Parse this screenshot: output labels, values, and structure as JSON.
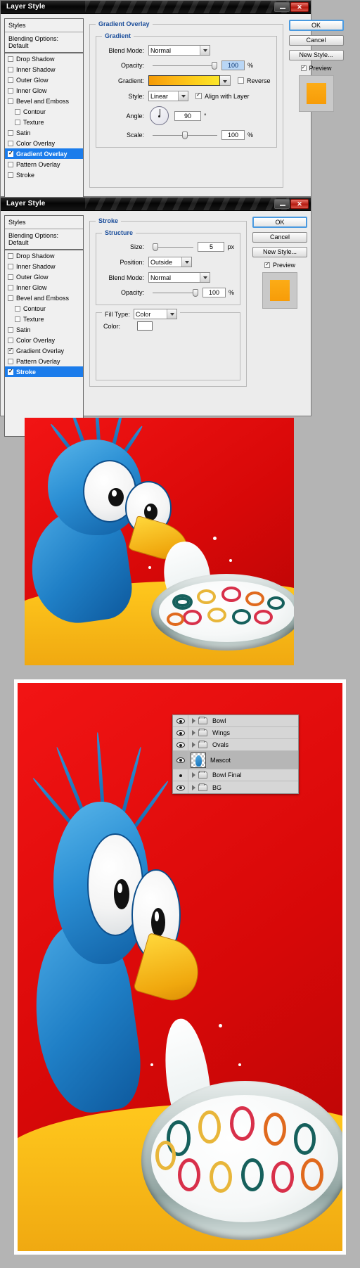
{
  "dialogs": [
    {
      "title": "Layer Style",
      "win_minimize": "",
      "win_close": "✕",
      "styles_header": "Styles",
      "blending_options": "Blending Options: Default",
      "style_items": [
        {
          "label": "Drop Shadow",
          "checked": false,
          "sub": false,
          "selected": false
        },
        {
          "label": "Inner Shadow",
          "checked": false,
          "sub": false,
          "selected": false
        },
        {
          "label": "Outer Glow",
          "checked": false,
          "sub": false,
          "selected": false
        },
        {
          "label": "Inner Glow",
          "checked": false,
          "sub": false,
          "selected": false
        },
        {
          "label": "Bevel and Emboss",
          "checked": false,
          "sub": false,
          "selected": false
        },
        {
          "label": "Contour",
          "checked": false,
          "sub": true,
          "selected": false
        },
        {
          "label": "Texture",
          "checked": false,
          "sub": true,
          "selected": false
        },
        {
          "label": "Satin",
          "checked": false,
          "sub": false,
          "selected": false
        },
        {
          "label": "Color Overlay",
          "checked": false,
          "sub": false,
          "selected": false
        },
        {
          "label": "Gradient Overlay",
          "checked": true,
          "sub": false,
          "selected": true
        },
        {
          "label": "Pattern Overlay",
          "checked": false,
          "sub": false,
          "selected": false
        },
        {
          "label": "Stroke",
          "checked": false,
          "sub": false,
          "selected": false
        }
      ],
      "panel_title": "Gradient Overlay",
      "group_title": "Gradient",
      "fields": {
        "blend_mode_label": "Blend Mode:",
        "blend_mode_value": "Normal",
        "opacity_label": "Opacity:",
        "opacity_value": "100",
        "opacity_unit": "%",
        "gradient_label": "Gradient:",
        "gradient_colors": "#f59b07 → #fae62a",
        "reverse_label": "Reverse",
        "reverse_checked": false,
        "style_label": "Style:",
        "style_value": "Linear",
        "align_label": "Align with Layer",
        "align_checked": true,
        "angle_label": "Angle:",
        "angle_value": "90",
        "angle_unit": "°",
        "scale_label": "Scale:",
        "scale_value": "100",
        "scale_unit": "%"
      },
      "buttons": {
        "ok": "OK",
        "cancel": "Cancel",
        "new_style": "New Style...",
        "preview": "Preview",
        "preview_checked": true
      }
    },
    {
      "title": "Layer Style",
      "win_minimize": "",
      "win_close": "✕",
      "styles_header": "Styles",
      "blending_options": "Blending Options: Default",
      "style_items": [
        {
          "label": "Drop Shadow",
          "checked": false,
          "sub": false,
          "selected": false
        },
        {
          "label": "Inner Shadow",
          "checked": false,
          "sub": false,
          "selected": false
        },
        {
          "label": "Outer Glow",
          "checked": false,
          "sub": false,
          "selected": false
        },
        {
          "label": "Inner Glow",
          "checked": false,
          "sub": false,
          "selected": false
        },
        {
          "label": "Bevel and Emboss",
          "checked": false,
          "sub": false,
          "selected": false
        },
        {
          "label": "Contour",
          "checked": false,
          "sub": true,
          "selected": false
        },
        {
          "label": "Texture",
          "checked": false,
          "sub": true,
          "selected": false
        },
        {
          "label": "Satin",
          "checked": false,
          "sub": false,
          "selected": false
        },
        {
          "label": "Color Overlay",
          "checked": false,
          "sub": false,
          "selected": false
        },
        {
          "label": "Gradient Overlay",
          "checked": true,
          "sub": false,
          "selected": false
        },
        {
          "label": "Pattern Overlay",
          "checked": false,
          "sub": false,
          "selected": false
        },
        {
          "label": "Stroke",
          "checked": true,
          "sub": false,
          "selected": true
        }
      ],
      "panel_title": "Stroke",
      "group_title": "Structure",
      "fields": {
        "size_label": "Size:",
        "size_value": "5",
        "size_unit": "px",
        "position_label": "Position:",
        "position_value": "Outside",
        "blend_mode_label": "Blend Mode:",
        "blend_mode_value": "Normal",
        "opacity_label": "Opacity:",
        "opacity_value": "100",
        "opacity_unit": "%",
        "fill_type_label": "Fill Type:",
        "fill_type_value": "Color",
        "color_label": "Color:",
        "color_value": "#ffffff"
      },
      "buttons": {
        "ok": "OK",
        "cancel": "Cancel",
        "new_style": "New Style...",
        "preview": "Preview",
        "preview_checked": true
      }
    }
  ],
  "illustrations": [
    {
      "name": "mascot-cereal-artwork-step1",
      "background_color": "#e01010",
      "table_color": "#ffc81d"
    },
    {
      "name": "mascot-cereal-artwork-final",
      "background_color": "#e01010",
      "table_color": "#ffc81d"
    }
  ],
  "layers_panel": {
    "rows": [
      {
        "name": "Bowl",
        "visible": true,
        "type": "group",
        "expanded": false
      },
      {
        "name": "Wings",
        "visible": true,
        "type": "group",
        "expanded": false
      },
      {
        "name": "Ovals",
        "visible": true,
        "type": "group",
        "expanded": false
      },
      {
        "name": "Mascot",
        "visible": true,
        "type": "layer",
        "expanded": false,
        "selected": true
      },
      {
        "name": "Bowl Final",
        "visible": false,
        "type": "group",
        "expanded": false
      },
      {
        "name": "BG",
        "visible": true,
        "type": "group",
        "expanded": false
      }
    ]
  }
}
